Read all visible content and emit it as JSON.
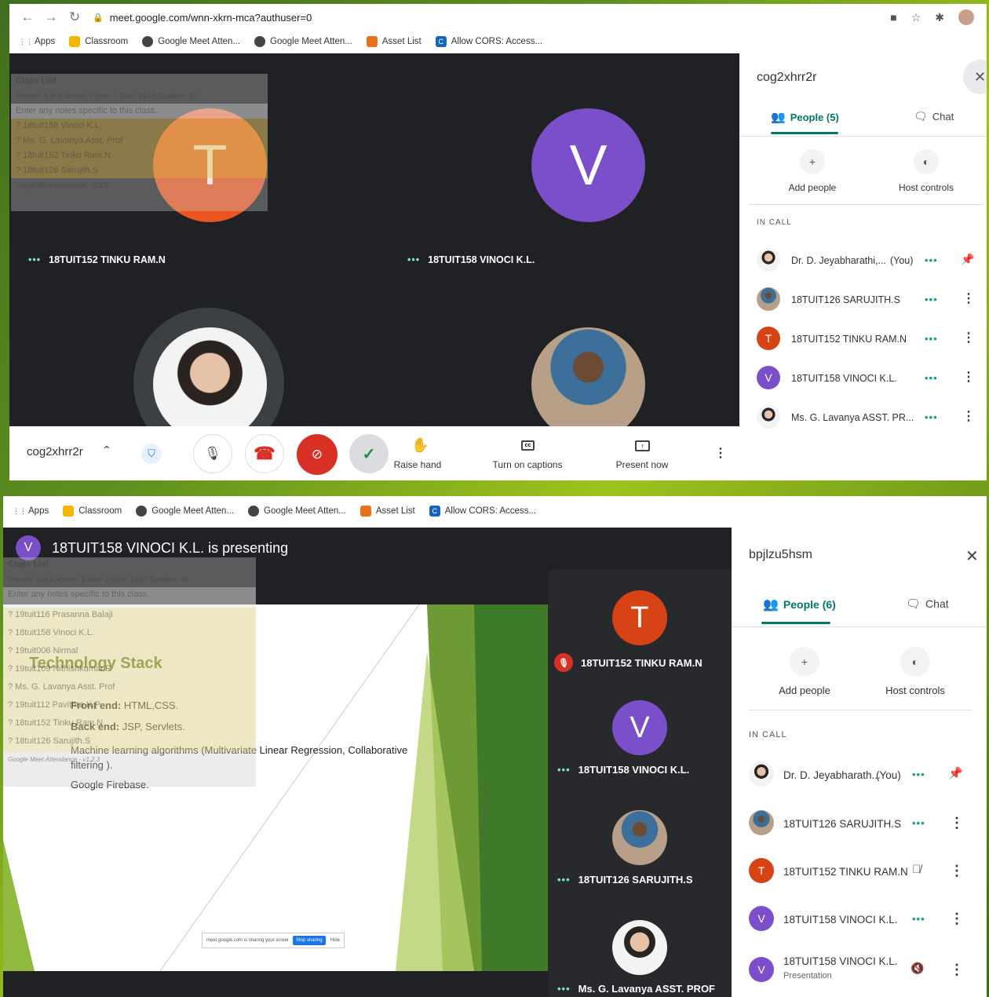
{
  "browser": {
    "url": "meet.google.com/wnn-xkrn-mca?authuser=0",
    "bookmarks": [
      "Apps",
      "Classroom",
      "Google Meet Atten...",
      "Google Meet Atten...",
      "Asset List",
      "Allow CORS: Access..."
    ]
  },
  "top": {
    "tiles": [
      {
        "initial": "T",
        "name": "18TUIT152 TINKU RAM.N",
        "color": "#e8551f"
      },
      {
        "initial": "V",
        "name": "18TUIT158 VINOCI K.L.",
        "color": "#7b4fc9"
      }
    ],
    "meeting_code": "cog2xhrr2r",
    "controls": {
      "raise_hand": "Raise hand",
      "captions": "Turn on captions",
      "present": "Present now"
    },
    "overlay": {
      "title": "Class List",
      "stats": "Present: 4 of 4    Absent: 0    New: 4    Start: 14:18    Duration: 17",
      "notes": "Enter any notes specific to this class.",
      "rows": [
        "? 18tuit158 Vinoci K.L.",
        "? Ms. G. Lavanya Asst. Prof",
        "? 18tuit152 Tinku Ram.N",
        "? 18tuit126 Sarujith.S"
      ],
      "footer": "Google Meet Attendance - v1.2.3"
    },
    "panel": {
      "title": "cog2xhrr2r",
      "people_tab": "People (5)",
      "chat_tab": "Chat",
      "add_people": "Add people",
      "host_controls": "Host controls",
      "in_call": "IN CALL",
      "participants": [
        {
          "name": "Dr. D. Jeyabharathi,...",
          "you": "(You)",
          "type": "photo"
        },
        {
          "name": "18TUIT126 SARUJITH.S",
          "type": "photo2"
        },
        {
          "name": "18TUIT152 TINKU RAM.N",
          "initial": "T",
          "color": "#d84315"
        },
        {
          "name": "18TUIT158 VINOCI K.L.",
          "initial": "V",
          "color": "#7b4fc9"
        },
        {
          "name": "Ms. G. Lavanya ASST. PR...",
          "type": "photo"
        }
      ]
    }
  },
  "bottom": {
    "presenting": "18TUIT158 VINOCI K.L. is presenting",
    "presenter_initial": "V",
    "slide": {
      "title": "Technology Stack",
      "bullets": [
        {
          "k": "Front end:",
          "v": " HTML,CSS."
        },
        {
          "k": "Back end:",
          "v": " JSP, Servlets."
        },
        {
          "k": "",
          "v": "Machine learning algorithms (Multivariate Linear Regression, Collaborative filtering )."
        },
        {
          "k": "",
          "v": "Google Firebase."
        }
      ],
      "share_text": "meet.google.com is sharing your screen.",
      "stop_sharing": "Stop sharing",
      "hide": "Hide"
    },
    "overlay": {
      "title": "Class List",
      "stats": "Present: 5 of 6    Absent: 3    New: 3    Start: 13:57    Duration: 48",
      "notes": "Enter any notes specific to this class.",
      "rows": [
        "? 19tuit116 Prasanna Balaji",
        "? 18tuit158 Vinoci K.L.",
        "? 19tuit006 Nirmal",
        "? 19tuit109 Nithishkumar.P",
        "? Ms. G. Lavanya Asst. Prof",
        "? 19tuit112 Pavithra K.P",
        "? 18tuit152 Tinku Ram.N",
        "? 18tuit126 Sarujith.S"
      ],
      "footer": "Google Meet Attendance - v1.2.3"
    },
    "tiles": [
      {
        "name": "18TUIT152 TINKU RAM.N",
        "initial": "T",
        "color": "#d84315",
        "muted": true
      },
      {
        "name": "18TUIT158 VINOCI K.L.",
        "initial": "V",
        "color": "#7b4fc9"
      },
      {
        "name": "18TUIT126 SARUJITH.S",
        "type": "photo2"
      },
      {
        "name": "Ms. G. Lavanya ASST. PROF",
        "type": "photo"
      }
    ],
    "panel": {
      "title": "bpjlzu5hsm",
      "people_tab": "People (6)",
      "chat_tab": "Chat",
      "add_people": "Add people",
      "host_controls": "Host controls",
      "in_call": "IN CALL",
      "participants": [
        {
          "name": "Dr. D. Jeyabharath...",
          "you": "(You)"
        },
        {
          "name": "18TUIT126 SARUJITH.S"
        },
        {
          "name": "18TUIT152 TINKU RAM.N",
          "initial": "T",
          "color": "#d84315"
        },
        {
          "name": "18TUIT158 VINOCI K.L.",
          "initial": "V",
          "color": "#7b4fc9"
        },
        {
          "name": "18TUIT158 VINOCI K.L.",
          "initial": "V",
          "color": "#7b4fc9",
          "sub": "Presentation"
        }
      ]
    }
  }
}
